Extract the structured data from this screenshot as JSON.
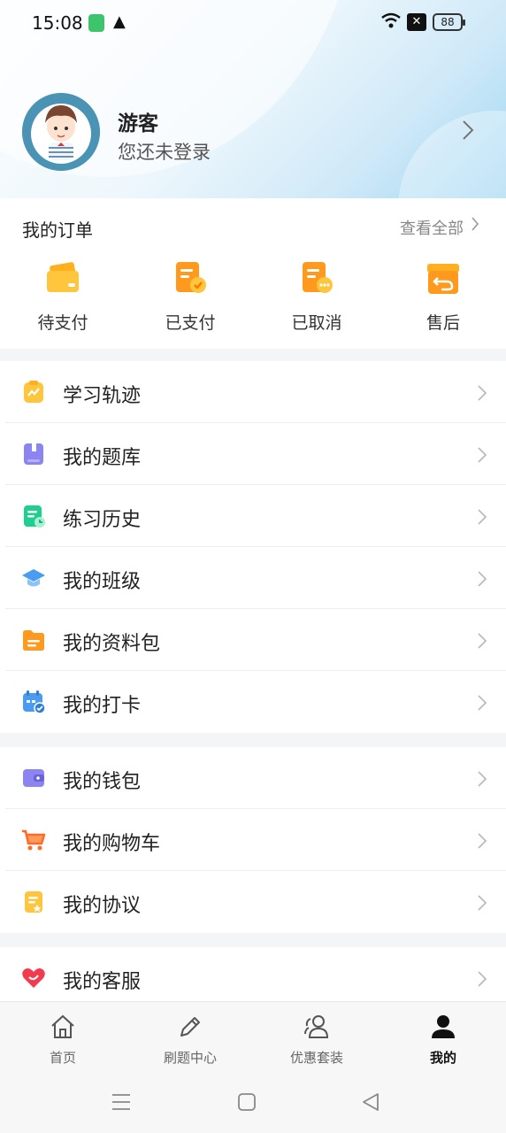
{
  "status_bar": {
    "time": "15:08",
    "battery": "88"
  },
  "profile": {
    "name": "游客",
    "subtitle": "您还未登录"
  },
  "orders": {
    "title": "我的订单",
    "view_all": "查看全部",
    "items": [
      {
        "label": "待支付",
        "icon": "wallet-card-icon"
      },
      {
        "label": "已支付",
        "icon": "paid-document-icon"
      },
      {
        "label": "已取消",
        "icon": "cancelled-document-icon"
      },
      {
        "label": "售后",
        "icon": "return-box-icon"
      }
    ]
  },
  "menu_groups": [
    [
      {
        "label": "学习轨迹",
        "icon": "chart-clipboard-icon"
      },
      {
        "label": "我的题库",
        "icon": "question-bank-icon"
      },
      {
        "label": "练习历史",
        "icon": "history-document-icon"
      },
      {
        "label": "我的班级",
        "icon": "graduation-cap-icon"
      },
      {
        "label": "我的资料包",
        "icon": "folder-icon"
      },
      {
        "label": "我的打卡",
        "icon": "calendar-check-icon"
      }
    ],
    [
      {
        "label": "我的钱包",
        "icon": "wallet-icon"
      },
      {
        "label": "我的购物车",
        "icon": "cart-icon"
      },
      {
        "label": "我的协议",
        "icon": "agreement-icon"
      }
    ],
    [
      {
        "label": "我的客服",
        "icon": "heart-support-icon"
      }
    ]
  ],
  "tabbar": {
    "items": [
      {
        "label": "首页",
        "icon": "home-icon"
      },
      {
        "label": "刷题中心",
        "icon": "pencil-icon"
      },
      {
        "label": "优惠套装",
        "icon": "users-icon"
      },
      {
        "label": "我的",
        "icon": "person-icon"
      }
    ],
    "active_index": 3
  },
  "colors": {
    "accent_blue": "#9fd6f2",
    "orange": "#ff9a1f",
    "yellow": "#ffc53d"
  }
}
